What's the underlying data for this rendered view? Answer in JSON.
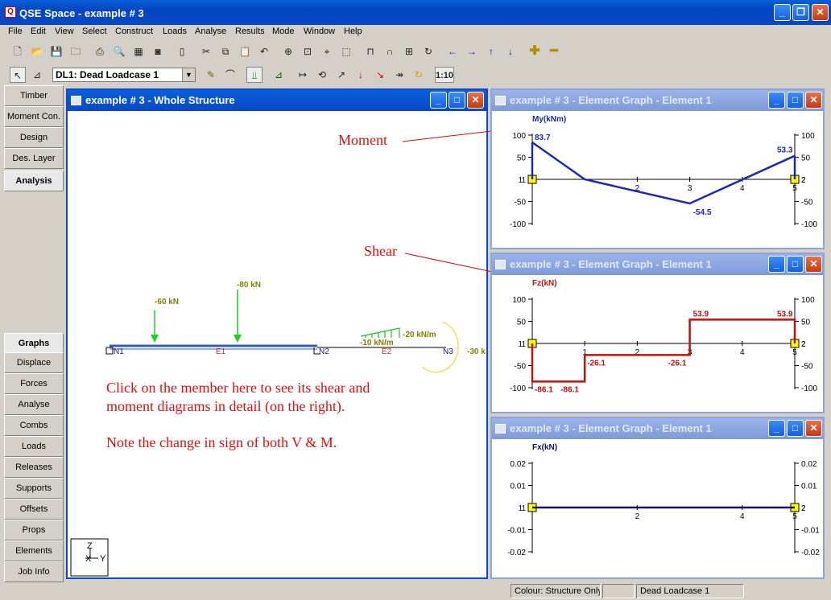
{
  "title": "QSE Space - example # 3",
  "menu": [
    "File",
    "Edit",
    "View",
    "Select",
    "Construct",
    "Loads",
    "Analyse",
    "Results",
    "Mode",
    "Window",
    "Help"
  ],
  "loadcase": "DL1: Dead Loadcase 1",
  "scale_label": "1:10",
  "sidebar_top": [
    "Timber",
    "Moment Con.",
    "Design",
    "Des. Layer",
    "Analysis"
  ],
  "sidebar_bottom": [
    "Graphs",
    "Displace",
    "Forces",
    "Analyse",
    "Combs",
    "Loads",
    "Releases",
    "Supports",
    "Offsets",
    "Props",
    "Elements",
    "Job Info"
  ],
  "main_window": {
    "title": "example # 3 - Whole Structure",
    "nodes": [
      "N1",
      "N2",
      "N3"
    ],
    "elements": [
      "E1",
      "E2"
    ],
    "loads": [
      "-60 kN",
      "-80 kN",
      "-20 kN/m",
      "-10 kN/m",
      "-30 k"
    ],
    "axes": {
      "z": "Z",
      "x": "X",
      "y": "Y"
    }
  },
  "annotations": {
    "moment": "Moment",
    "shear": "Shear",
    "line1": "Click on the member here to see its shear and",
    "line2": "moment diagrams in detail (on the right).",
    "line3": "Note the change in sign of both V & M."
  },
  "graph_windows": [
    {
      "title": "example # 3 - Element Graph - Element 1",
      "ylabel": "My(kNm)",
      "color": "#1c28b4"
    },
    {
      "title": "example # 3 - Element Graph - Element 1",
      "ylabel": "Fz(kN)",
      "color": "#c01010"
    },
    {
      "title": "example # 3 - Element Graph - Element 1",
      "ylabel": "Fx(kN)",
      "color": "#101060"
    }
  ],
  "chart_data": [
    {
      "type": "line",
      "ylabel": "My(kNm)",
      "yticks": [
        "100",
        "50",
        "1",
        "-50",
        "-100"
      ],
      "yticks_right": [
        "100",
        "50",
        "2",
        "-50",
        "-100"
      ],
      "xticks": [
        "2",
        "3",
        "4",
        "5"
      ],
      "x": [
        0,
        1,
        3,
        5
      ],
      "y": [
        83.7,
        0,
        -54.5,
        53.3
      ],
      "labels": [
        "83.7",
        "-54.5",
        "53.3"
      ],
      "ylim": [
        -100,
        100
      ]
    },
    {
      "type": "line",
      "ylabel": "Fz(kN)",
      "yticks": [
        "100",
        "50",
        "1",
        "-50",
        "-100"
      ],
      "yticks_right": [
        "100",
        "50",
        "2",
        "-50",
        "-100"
      ],
      "xticks": [
        "1",
        "2",
        "3",
        "4",
        "5"
      ],
      "y_segments": [
        -86.1,
        -26.1,
        53.9
      ],
      "labels": [
        "-86.1",
        "-86.1",
        "-26.1",
        "-26.1",
        "53.9",
        "53.9"
      ],
      "ylim": [
        -100,
        100
      ]
    },
    {
      "type": "line",
      "ylabel": "Fx(kN)",
      "yticks": [
        "0.02",
        "0.01",
        "1",
        "-0.01",
        "-0.02"
      ],
      "yticks_right": [
        "0.02",
        "0.01",
        "2",
        "-0.01",
        "-0.02"
      ],
      "xticks": [
        "2",
        "4",
        "5"
      ],
      "y": [
        0,
        0
      ],
      "ylim": [
        -0.02,
        0.02
      ]
    }
  ],
  "status": [
    "Colour: Structure Only",
    "",
    "Dead Loadcase 1"
  ]
}
